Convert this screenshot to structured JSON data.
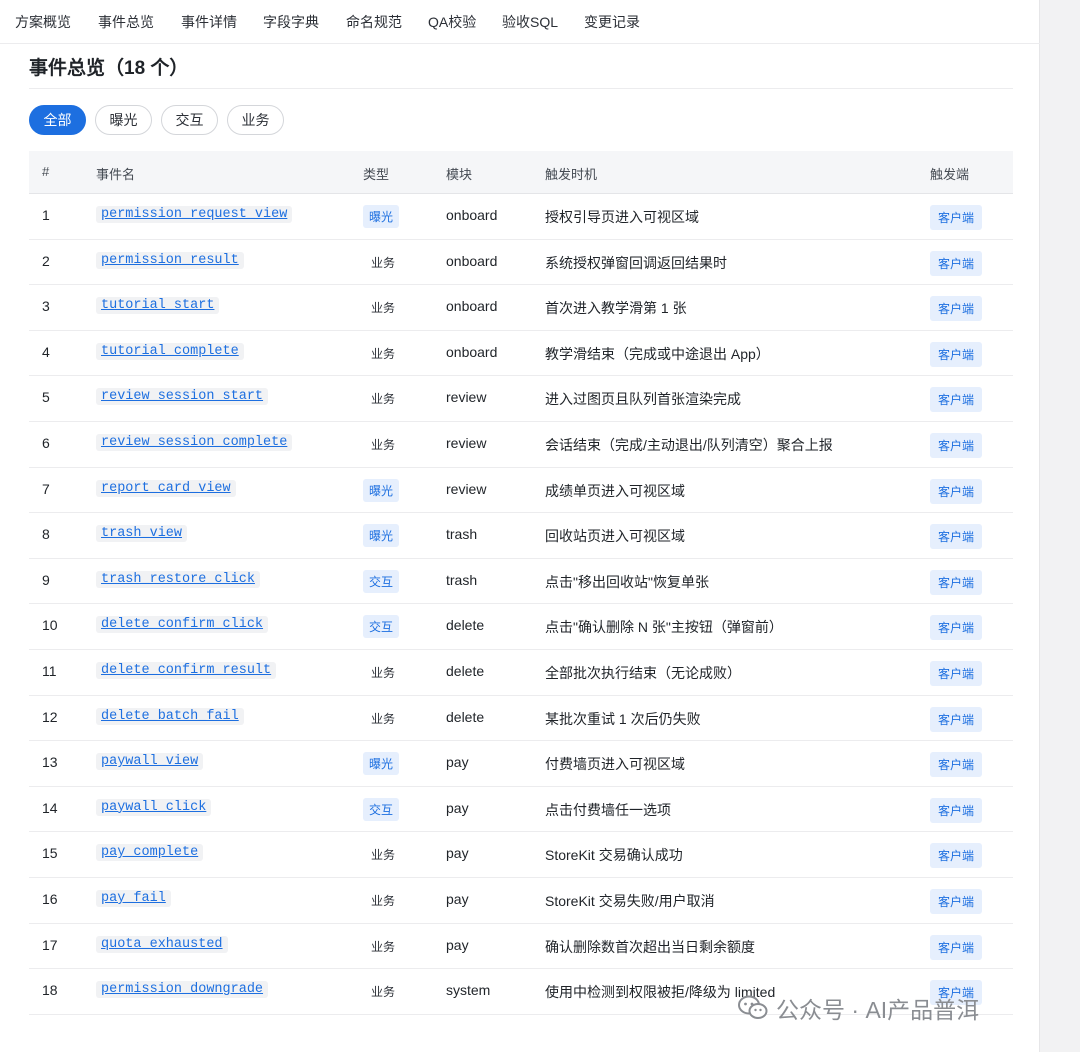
{
  "nav": {
    "items": [
      "方案概览",
      "事件总览",
      "事件详情",
      "字段字典",
      "命名规范",
      "QA校验",
      "验收SQL",
      "变更记录"
    ]
  },
  "page": {
    "title": "事件总览（18 个）"
  },
  "filters": [
    "全部",
    "曝光",
    "交互",
    "业务"
  ],
  "table": {
    "headers": [
      "#",
      "事件名",
      "类型",
      "模块",
      "触发时机",
      "触发端"
    ],
    "rows": [
      {
        "num": "1",
        "name": "permission_request_view",
        "type": "曝光",
        "module": "onboard",
        "trigger": "授权引导页进入可视区域",
        "client": "客户端"
      },
      {
        "num": "2",
        "name": "permission_result",
        "type": "业务",
        "module": "onboard",
        "trigger": "系统授权弹窗回调返回结果时",
        "client": "客户端"
      },
      {
        "num": "3",
        "name": "tutorial_start",
        "type": "业务",
        "module": "onboard",
        "trigger": "首次进入教学滑第 1 张",
        "client": "客户端"
      },
      {
        "num": "4",
        "name": "tutorial_complete",
        "type": "业务",
        "module": "onboard",
        "trigger": "教学滑结束（完成或中途退出 App）",
        "client": "客户端"
      },
      {
        "num": "5",
        "name": "review_session_start",
        "type": "业务",
        "module": "review",
        "trigger": "进入过图页且队列首张渲染完成",
        "client": "客户端"
      },
      {
        "num": "6",
        "name": "review_session_complete",
        "type": "业务",
        "module": "review",
        "trigger": "会话结束（完成/主动退出/队列清空）聚合上报",
        "client": "客户端"
      },
      {
        "num": "7",
        "name": "report_card_view",
        "type": "曝光",
        "module": "review",
        "trigger": "成绩单页进入可视区域",
        "client": "客户端"
      },
      {
        "num": "8",
        "name": "trash_view",
        "type": "曝光",
        "module": "trash",
        "trigger": "回收站页进入可视区域",
        "client": "客户端"
      },
      {
        "num": "9",
        "name": "trash_restore_click",
        "type": "交互",
        "module": "trash",
        "trigger": "点击\"移出回收站\"恢复单张",
        "client": "客户端"
      },
      {
        "num": "10",
        "name": "delete_confirm_click",
        "type": "交互",
        "module": "delete",
        "trigger": "点击\"确认删除 N 张\"主按钮（弹窗前）",
        "client": "客户端"
      },
      {
        "num": "11",
        "name": "delete_confirm_result",
        "type": "业务",
        "module": "delete",
        "trigger": "全部批次执行结束（无论成败）",
        "client": "客户端"
      },
      {
        "num": "12",
        "name": "delete_batch_fail",
        "type": "业务",
        "module": "delete",
        "trigger": "某批次重试 1 次后仍失败",
        "client": "客户端"
      },
      {
        "num": "13",
        "name": "paywall_view",
        "type": "曝光",
        "module": "pay",
        "trigger": "付费墙页进入可视区域",
        "client": "客户端"
      },
      {
        "num": "14",
        "name": "paywall_click",
        "type": "交互",
        "module": "pay",
        "trigger": "点击付费墙任一选项",
        "client": "客户端"
      },
      {
        "num": "15",
        "name": "pay_complete",
        "type": "业务",
        "module": "pay",
        "trigger": "StoreKit 交易确认成功",
        "client": "客户端"
      },
      {
        "num": "16",
        "name": "pay_fail",
        "type": "业务",
        "module": "pay",
        "trigger": "StoreKit 交易失败/用户取消",
        "client": "客户端"
      },
      {
        "num": "17",
        "name": "quota_exhausted",
        "type": "业务",
        "module": "pay",
        "trigger": "确认删除数首次超出当日剩余额度",
        "client": "客户端"
      },
      {
        "num": "18",
        "name": "permission_downgrade",
        "type": "业务",
        "module": "system",
        "trigger": "使用中检测到权限被拒/降级为 limited",
        "client": "客户端"
      }
    ]
  },
  "watermark": {
    "text": "公众号 · AI产品普洱"
  },
  "colors": {
    "accent": "#1d6fe0",
    "badge_bg": "#e6effd"
  }
}
